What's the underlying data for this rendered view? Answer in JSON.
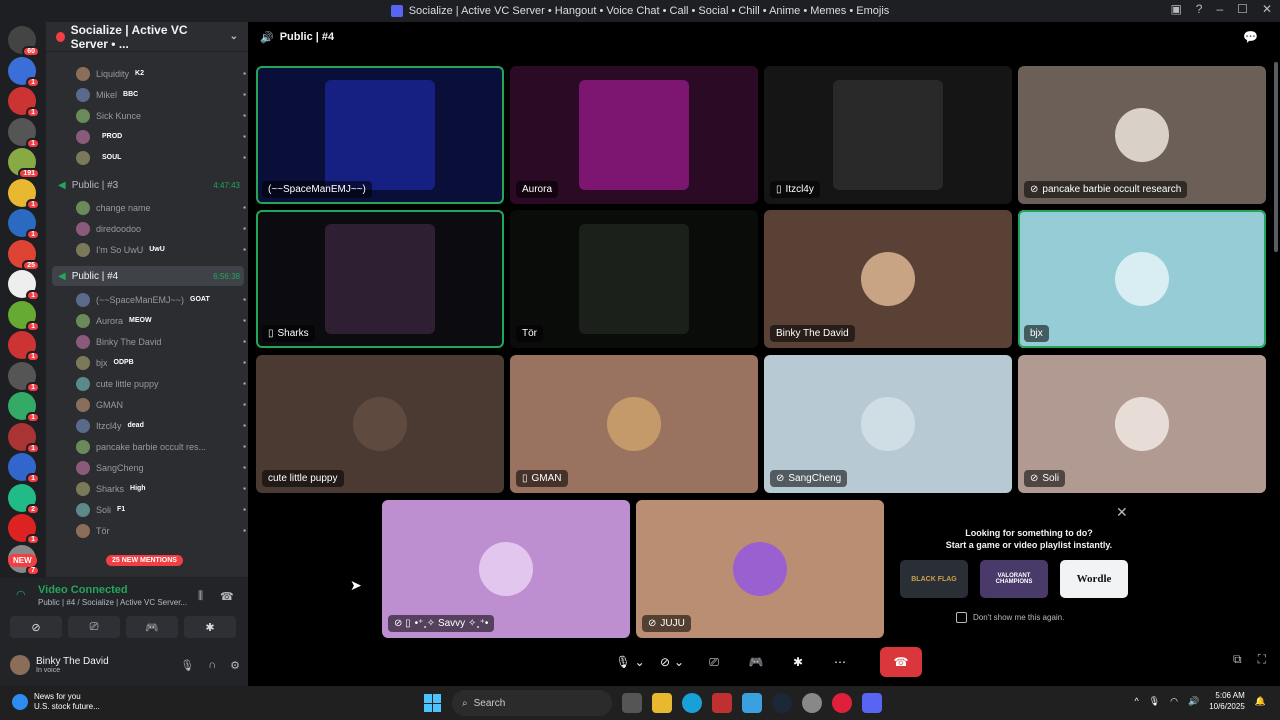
{
  "window": {
    "title": "Socialize | Active VC Server • Hangout • Voice Chat • Call • Social • Chill • Anime • Memes • Emojis"
  },
  "server_badges": [
    "60",
    "1",
    "1",
    "1",
    "191",
    "1",
    "1",
    "25",
    "1",
    "1",
    "1",
    "1",
    "1",
    "1",
    "1",
    "2",
    "1",
    "7"
  ],
  "new_label": "NEW",
  "sidebar": {
    "server_name": "Socialize | Active VC Server • ...",
    "top_members": [
      {
        "name": "Liquidity",
        "tag": "K2"
      },
      {
        "name": "Mikel",
        "tag": "BBC"
      },
      {
        "name": "Sick Kunce",
        "tag": ""
      },
      {
        "name": "",
        "tag": "PROD"
      },
      {
        "name": "",
        "tag": "SOUL"
      }
    ],
    "channel3": {
      "name": "Public | #3",
      "time": "4:47:43"
    },
    "channel3_members": [
      {
        "name": "change name",
        "tag": ""
      },
      {
        "name": "diredoodoo",
        "tag": ""
      },
      {
        "name": "I'm So UwU",
        "tag": "UwU"
      }
    ],
    "channel4": {
      "name": "Public | #4",
      "time": "6:56:38"
    },
    "channel4_members": [
      {
        "name": "(~~SpaceManEMJ~~)",
        "tag": "GOAT"
      },
      {
        "name": "Aurora",
        "tag": "MEOW"
      },
      {
        "name": "Binky The David",
        "tag": ""
      },
      {
        "name": "bjx",
        "tag": "ODPB"
      },
      {
        "name": "cute little puppy",
        "tag": ""
      },
      {
        "name": "GMAN",
        "tag": ""
      },
      {
        "name": "Itzcl4y",
        "tag": "dead"
      },
      {
        "name": "pancake barbie occult res...",
        "tag": ""
      },
      {
        "name": "SangCheng",
        "tag": ""
      },
      {
        "name": "Sharks",
        "tag": "High"
      },
      {
        "name": "Soli",
        "tag": "F1"
      },
      {
        "name": "Tör",
        "tag": ""
      }
    ],
    "mentions_pill": "25 NEW MENTIONS"
  },
  "voice_panel": {
    "status": "Video Connected",
    "location": "Public | #4 / Socialize | Active VC Server..."
  },
  "user": {
    "name": "Binky The David",
    "status": "In voice"
  },
  "stage": {
    "channel_name": "Public | #4",
    "tiles": [
      {
        "name": "(~~SpaceManEMJ~~)",
        "bg": "#0a0f3a",
        "accent": "#2030c0",
        "speaking": true,
        "icon": ""
      },
      {
        "name": "Aurora",
        "bg": "#2a0a24",
        "accent": "#c020b0",
        "speaking": false,
        "icon": ""
      },
      {
        "name": "Itzcl4y",
        "bg": "#151515",
        "accent": "#3a3a3a",
        "speaking": false,
        "icon": "▯"
      },
      {
        "name": "pancake barbie occult research",
        "bg": "#6b5f58",
        "accent": "#d9d1c8",
        "speaking": false,
        "icon": "⊘"
      },
      {
        "name": "Sharks",
        "bg": "#0c0c10",
        "accent": "#4a3050",
        "speaking": true,
        "icon": "▯"
      },
      {
        "name": "Tör",
        "bg": "#0a0c0a",
        "accent": "#2a3328",
        "speaking": false,
        "icon": ""
      },
      {
        "name": "Binky The David",
        "bg": "#5a4136",
        "accent": "#c9a484",
        "speaking": false,
        "icon": ""
      },
      {
        "name": "bjx",
        "bg": "#96ccd6",
        "accent": "#d8eef2",
        "speaking": true,
        "icon": ""
      },
      {
        "name": "cute little puppy",
        "bg": "#4a3a32",
        "accent": "#5e4a3e",
        "speaking": false,
        "icon": ""
      },
      {
        "name": "GMAN",
        "bg": "#9a7260",
        "accent": "#c49a6a",
        "speaking": false,
        "icon": "▯"
      },
      {
        "name": "SangCheng",
        "bg": "#b7cad4",
        "accent": "#cfdde4",
        "speaking": false,
        "icon": "⊘"
      },
      {
        "name": "Soli",
        "bg": "#b09a92",
        "accent": "#e8dcd6",
        "speaking": false,
        "icon": "⊘"
      },
      {
        "name": "•⁺˳✧ Savvy ✧˳⁺•",
        "bg": "#bd8ed0",
        "accent": "#e2c6ee",
        "speaking": false,
        "icon": "⊘ ▯"
      },
      {
        "name": "JUJU",
        "bg": "#b98e72",
        "accent": "#9a60d0",
        "speaking": false,
        "icon": "⊘"
      }
    ]
  },
  "promo": {
    "line1": "Looking for something to do?",
    "line2": "Start a game or video playlist instantly.",
    "games": [
      "BLACK FLAG",
      "VALORANT CHAMPIONS",
      "Wordle"
    ],
    "dont_show": "Don't show me this again."
  },
  "taskbar": {
    "news_title": "News for you",
    "news_sub": "U.S. stock future...",
    "search": "Search",
    "time": "5:06 AM",
    "date": "10/6/2025"
  }
}
